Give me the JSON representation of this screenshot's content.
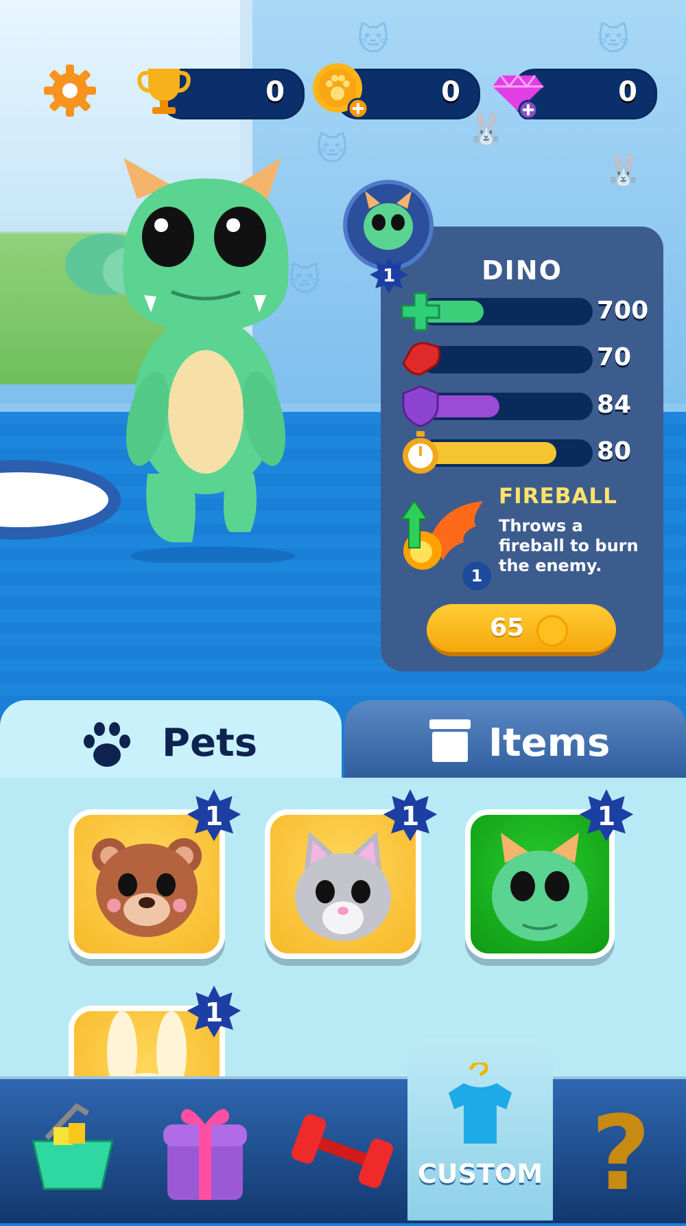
{
  "hud": {
    "trophies": "0",
    "paw_coins": "0",
    "gems": "0"
  },
  "pet": {
    "name": "DINO",
    "level": "1",
    "stats": [
      {
        "icon": "health-cross-icon",
        "value": "700",
        "fill": 0.37,
        "color": "#3ccf7a"
      },
      {
        "icon": "attack-fist-icon",
        "value": "70",
        "fill": 0.05,
        "color": "#e53030"
      },
      {
        "icon": "defense-shield-icon",
        "value": "84",
        "fill": 0.46,
        "color": "#9b4bd6"
      },
      {
        "icon": "speed-stopwatch-icon",
        "value": "80",
        "fill": 0.79,
        "color": "#f2c531"
      }
    ],
    "skill": {
      "name": "FIREBALL",
      "description": "Throws a fireball to burn the enemy.",
      "level": "1"
    },
    "upgrade_price": "65"
  },
  "tabs": {
    "pets": "Pets",
    "items": "Items"
  },
  "pets_grid": [
    {
      "name": "bear",
      "level": "1",
      "selected": false
    },
    {
      "name": "cat",
      "level": "1",
      "selected": false
    },
    {
      "name": "dino",
      "level": "1",
      "selected": true
    },
    {
      "name": "bunny",
      "level": "1",
      "selected": false
    }
  ],
  "nav": {
    "custom": "CUSTOM"
  }
}
